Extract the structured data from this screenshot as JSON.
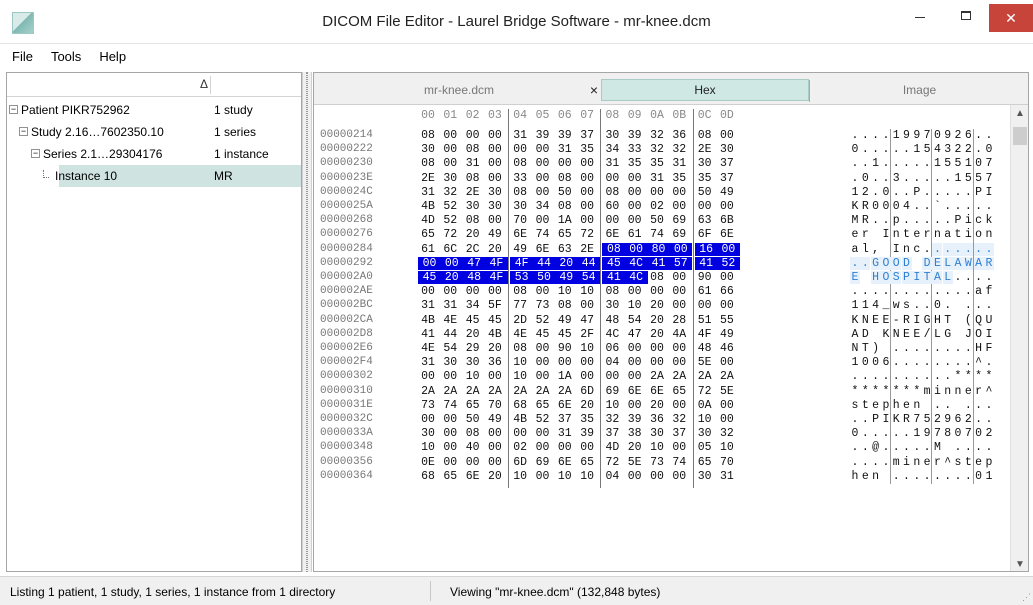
{
  "window": {
    "title": "DICOM File Editor - Laurel Bridge Software - mr-knee.dcm"
  },
  "menu": [
    "File",
    "Tools",
    "Help"
  ],
  "tree": {
    "sort_glyph": "Δ",
    "rows": [
      {
        "label": "Patient PIKR752962",
        "info": "1 study",
        "toggle": "−",
        "level": 0
      },
      {
        "label": "Study 2.16…7602350.10",
        "info": "1 series",
        "toggle": "−",
        "level": 1
      },
      {
        "label": "Series 2.1…29304176",
        "info": "1 instance",
        "toggle": "−",
        "level": 2
      },
      {
        "label": "Instance 10",
        "info": "MR",
        "toggle": "",
        "level": 3,
        "selected": true
      }
    ]
  },
  "tabs": {
    "file": "mr-knee.dcm",
    "close": "×",
    "hex": "Hex",
    "image": "Image"
  },
  "hex": {
    "columns": [
      "00",
      "01",
      "02",
      "03",
      "04",
      "05",
      "06",
      "07",
      "08",
      "09",
      "0A",
      "0B",
      "0C",
      "0D"
    ],
    "rows": [
      {
        "addr": "00000214",
        "bytes": [
          "08",
          "00",
          "00",
          "00",
          "31",
          "39",
          "39",
          "37",
          "30",
          "39",
          "32",
          "36",
          "08",
          "00"
        ],
        "ascii": "....19970926.."
      },
      {
        "addr": "00000222",
        "bytes": [
          "30",
          "00",
          "08",
          "00",
          "00",
          "00",
          "31",
          "35",
          "34",
          "33",
          "32",
          "32",
          "2E",
          "30"
        ],
        "ascii": "0.....154322.0"
      },
      {
        "addr": "00000230",
        "bytes": [
          "08",
          "00",
          "31",
          "00",
          "08",
          "00",
          "00",
          "00",
          "31",
          "35",
          "35",
          "31",
          "30",
          "37"
        ],
        "ascii": "..1.....155107"
      },
      {
        "addr": "0000023E",
        "bytes": [
          "2E",
          "30",
          "08",
          "00",
          "33",
          "00",
          "08",
          "00",
          "00",
          "00",
          "31",
          "35",
          "35",
          "37"
        ],
        "ascii": ".0..3.....1557"
      },
      {
        "addr": "0000024C",
        "bytes": [
          "31",
          "32",
          "2E",
          "30",
          "08",
          "00",
          "50",
          "00",
          "08",
          "00",
          "00",
          "00",
          "50",
          "49"
        ],
        "ascii": "12.0..P.....PI"
      },
      {
        "addr": "0000025A",
        "bytes": [
          "4B",
          "52",
          "30",
          "30",
          "30",
          "34",
          "08",
          "00",
          "60",
          "00",
          "02",
          "00",
          "00",
          "00"
        ],
        "ascii": "KR0004..`....."
      },
      {
        "addr": "00000268",
        "bytes": [
          "4D",
          "52",
          "08",
          "00",
          "70",
          "00",
          "1A",
          "00",
          "00",
          "00",
          "50",
          "69",
          "63",
          "6B"
        ],
        "ascii": "MR..p.....Pick"
      },
      {
        "addr": "00000276",
        "bytes": [
          "65",
          "72",
          "20",
          "49",
          "6E",
          "74",
          "65",
          "72",
          "6E",
          "61",
          "74",
          "69",
          "6F",
          "6E"
        ],
        "ascii": "er Internation"
      },
      {
        "addr": "00000284",
        "bytes": [
          "61",
          "6C",
          "2C",
          "20",
          "49",
          "6E",
          "63",
          "2E",
          "08",
          "00",
          "80",
          "00",
          "16",
          "00"
        ],
        "ascii": "al, Inc.......",
        "sel_from": 8
      },
      {
        "addr": "00000292",
        "bytes": [
          "00",
          "00",
          "47",
          "4F",
          "4F",
          "44",
          "20",
          "44",
          "45",
          "4C",
          "41",
          "57",
          "41",
          "52"
        ],
        "ascii": "..GOOD DELAWAR",
        "sel_from": 0
      },
      {
        "addr": "000002A0",
        "bytes": [
          "45",
          "20",
          "48",
          "4F",
          "53",
          "50",
          "49",
          "54",
          "41",
          "4C",
          "08",
          "00",
          "90",
          "00"
        ],
        "ascii": "E HOSPITAL....",
        "sel_from": 0,
        "sel_to": 9
      },
      {
        "addr": "000002AE",
        "bytes": [
          "00",
          "00",
          "00",
          "00",
          "08",
          "00",
          "10",
          "10",
          "08",
          "00",
          "00",
          "00",
          "61",
          "66"
        ],
        "ascii": "............af"
      },
      {
        "addr": "000002BC",
        "bytes": [
          "31",
          "31",
          "34",
          "5F",
          "77",
          "73",
          "08",
          "00",
          "30",
          "10",
          "20",
          "00",
          "00",
          "00"
        ],
        "ascii": "114_ws..0. ..."
      },
      {
        "addr": "000002CA",
        "bytes": [
          "4B",
          "4E",
          "45",
          "45",
          "2D",
          "52",
          "49",
          "47",
          "48",
          "54",
          "20",
          "28",
          "51",
          "55"
        ],
        "ascii": "KNEE-RIGHT (QU"
      },
      {
        "addr": "000002D8",
        "bytes": [
          "41",
          "44",
          "20",
          "4B",
          "4E",
          "45",
          "45",
          "2F",
          "4C",
          "47",
          "20",
          "4A",
          "4F",
          "49"
        ],
        "ascii": "AD KNEE/LG JOI"
      },
      {
        "addr": "000002E6",
        "bytes": [
          "4E",
          "54",
          "29",
          "20",
          "08",
          "00",
          "90",
          "10",
          "06",
          "00",
          "00",
          "00",
          "48",
          "46"
        ],
        "ascii": "NT) ........HF"
      },
      {
        "addr": "000002F4",
        "bytes": [
          "31",
          "30",
          "30",
          "36",
          "10",
          "00",
          "00",
          "00",
          "04",
          "00",
          "00",
          "00",
          "5E",
          "00"
        ],
        "ascii": "1006........^."
      },
      {
        "addr": "00000302",
        "bytes": [
          "00",
          "00",
          "10",
          "00",
          "10",
          "00",
          "1A",
          "00",
          "00",
          "00",
          "2A",
          "2A",
          "2A",
          "2A"
        ],
        "ascii": "..........****"
      },
      {
        "addr": "00000310",
        "bytes": [
          "2A",
          "2A",
          "2A",
          "2A",
          "2A",
          "2A",
          "2A",
          "6D",
          "69",
          "6E",
          "6E",
          "65",
          "72",
          "5E"
        ],
        "ascii": "*******minner^"
      },
      {
        "addr": "0000031E",
        "bytes": [
          "73",
          "74",
          "65",
          "70",
          "68",
          "65",
          "6E",
          "20",
          "10",
          "00",
          "20",
          "00",
          "0A",
          "00"
        ],
        "ascii": "stephen .. ..."
      },
      {
        "addr": "0000032C",
        "bytes": [
          "00",
          "00",
          "50",
          "49",
          "4B",
          "52",
          "37",
          "35",
          "32",
          "39",
          "36",
          "32",
          "10",
          "00"
        ],
        "ascii": "..PIKR752962.."
      },
      {
        "addr": "0000033A",
        "bytes": [
          "30",
          "00",
          "08",
          "00",
          "00",
          "00",
          "31",
          "39",
          "37",
          "38",
          "30",
          "37",
          "30",
          "32"
        ],
        "ascii": "0.....19780702"
      },
      {
        "addr": "00000348",
        "bytes": [
          "10",
          "00",
          "40",
          "00",
          "02",
          "00",
          "00",
          "00",
          "4D",
          "20",
          "10",
          "00",
          "05",
          "10"
        ],
        "ascii": "..@.....M ...."
      },
      {
        "addr": "00000356",
        "bytes": [
          "0E",
          "00",
          "00",
          "00",
          "6D",
          "69",
          "6E",
          "65",
          "72",
          "5E",
          "73",
          "74",
          "65",
          "70"
        ],
        "ascii": "....miner^step"
      },
      {
        "addr": "00000364",
        "bytes": [
          "68",
          "65",
          "6E",
          "20",
          "10",
          "00",
          "10",
          "10",
          "04",
          "00",
          "00",
          "00",
          "30",
          "31"
        ],
        "ascii": "hen ........01"
      }
    ]
  },
  "status": {
    "left": "Listing 1 patient, 1 study, 1 series, 1 instance from 1 directory",
    "right": "Viewing \"mr-knee.dcm\" (132,848 bytes)"
  }
}
